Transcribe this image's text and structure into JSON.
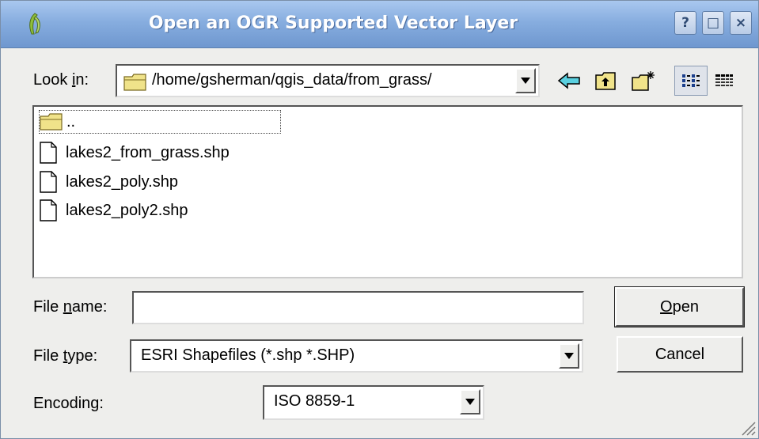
{
  "window": {
    "title": "Open an OGR Supported Vector Layer",
    "help_btn": "?",
    "max_btn": "□",
    "close_btn": "×"
  },
  "lookin": {
    "label_pre": "Look ",
    "label_key": "i",
    "label_post": "n:",
    "path": "/home/gsherman/qgis_data/from_grass/"
  },
  "toolbar": {
    "icons": [
      "back-arrow-icon",
      "parent-folder-icon",
      "new-folder-icon",
      "detail-view-icon",
      "list-view-icon"
    ]
  },
  "files": [
    {
      "name": "..",
      "type": "folder"
    },
    {
      "name": "lakes2_from_grass.shp",
      "type": "file"
    },
    {
      "name": "lakes2_poly.shp",
      "type": "file"
    },
    {
      "name": "lakes2_poly2.shp",
      "type": "file"
    }
  ],
  "filename": {
    "label_pre": "File ",
    "label_key": "n",
    "label_post": "ame:",
    "value": ""
  },
  "filetype": {
    "label_pre": "File ",
    "label_key": "t",
    "label_post": "ype:",
    "selected": "ESRI Shapefiles (*.shp *.SHP)"
  },
  "encoding": {
    "label": "Encoding:",
    "selected": "ISO 8859-1"
  },
  "buttons": {
    "open_key": "O",
    "open_rest": "pen",
    "cancel": "Cancel"
  },
  "colors": {
    "titlebar": "#87addf",
    "dialog_bg": "#eeeeec",
    "folder": "#f0e38a"
  }
}
